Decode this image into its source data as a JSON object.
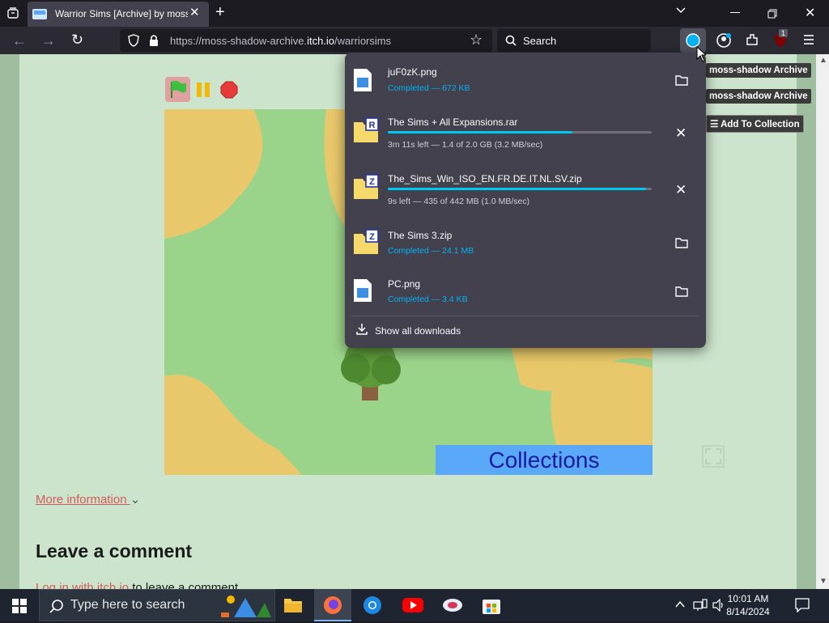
{
  "browser": {
    "tab_title": "Warrior Sims [Archive] by moss-shadow Archive",
    "url_prefix": "https://moss-shadow-archive.",
    "url_domain": "itch.io",
    "url_path": "/warriorsims",
    "search_placeholder": "Search",
    "addon_badge": "1"
  },
  "page": {
    "archive_button_1": "moss-shadow Archive",
    "archive_button_2": "moss-shadow Archive",
    "add_collection": "Add To Collection",
    "game_banner": "Collections",
    "more_info": "More information",
    "leave_comment": "Leave a comment",
    "login_link": "Log in with itch.io",
    "login_rest": " to leave a comment."
  },
  "downloads": {
    "items": [
      {
        "name": "juF0zK.png",
        "status": "Completed — 672 KB",
        "state": "done",
        "icon": "image-file-icon"
      },
      {
        "name": "The Sims + All Expansions.rar",
        "status": "3m 11s left — 1.4 of 2.0 GB (3.2 MB/sec)",
        "state": "progress",
        "progress": 0.7,
        "icon": "rar-archive-icon",
        "badge": "R"
      },
      {
        "name": "The_Sims_Win_ISO_EN.FR.DE.IT.NL.SV.zip",
        "status": "9s left — 435 of 442 MB (1.0 MB/sec)",
        "state": "progress",
        "progress": 0.98,
        "icon": "zip-archive-icon",
        "badge": "Z"
      },
      {
        "name": "The Sims 3.zip",
        "status": "Completed — 24.1 MB",
        "state": "done",
        "icon": "zip-archive-icon",
        "badge": "Z"
      },
      {
        "name": "PC.png",
        "status": "Completed — 3.4 KB",
        "state": "done",
        "icon": "image-file-icon"
      }
    ],
    "show_all": "Show all downloads"
  },
  "taskbar": {
    "search_placeholder": "Type here to search",
    "time": "10:01 AM",
    "date": "8/14/2024"
  },
  "colors": {
    "accent": "#00c8f0",
    "page_bg": "#cce4cc",
    "link": "#d25a5a"
  }
}
